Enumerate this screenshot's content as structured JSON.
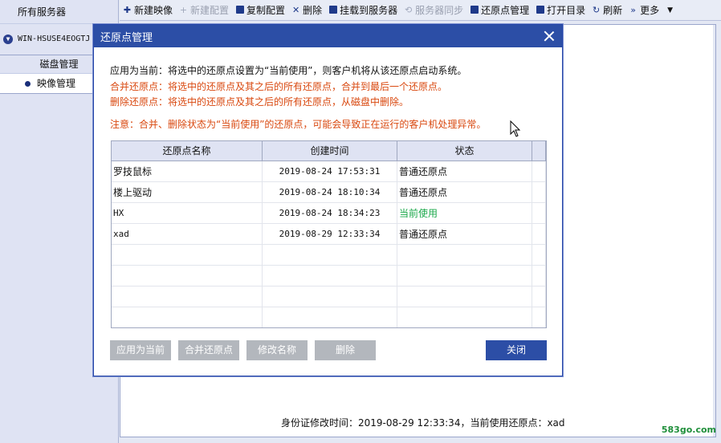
{
  "sidebar": {
    "header": "所有服务器",
    "server_name": "WIN-HSUSE4EOGTJ",
    "disk_mgmt": "磁盘管理",
    "image_mgmt": "映像管理"
  },
  "toolbar": {
    "new_image": "新建映像",
    "new_config": "新建配置",
    "copy_config": "复制配置",
    "delete": "删除",
    "mount_server": "挂载到服务器",
    "server_sync": "服务器同步",
    "restore_mgmt": "还原点管理",
    "open_dir": "打开目录",
    "refresh": "刷新",
    "more": "更多"
  },
  "dialog": {
    "title": "还原点管理",
    "desc_apply": "应用为当前：将选中的还原点设置为“当前使用”，则客户机将从该还原点启动系统。",
    "desc_merge": "合并还原点：将选中的还原点及其之后的所有还原点，合并到最后一个还原点。",
    "desc_delete": "删除还原点：将选中的还原点及其之后的所有还原点，从磁盘中删除。",
    "warning": "注意：合并、删除状态为“当前使用”的还原点，可能会导致正在运行的客户机处理异常。",
    "table": {
      "headers": [
        "还原点名称",
        "创建时间",
        "状态"
      ],
      "rows": [
        {
          "name": "罗技鼠标",
          "time": "2019-08-24 17:53:31",
          "status": "普通还原点"
        },
        {
          "name": "楼上驱动",
          "time": "2019-08-24 18:10:34",
          "status": "普通还原点"
        },
        {
          "name": "HX",
          "time": "2019-08-24 18:34:23",
          "status": "当前使用"
        },
        {
          "name": "xad",
          "time": "2019-08-29 12:33:34",
          "status": "普通还原点"
        }
      ]
    },
    "buttons": {
      "apply": "应用为当前",
      "merge": "合并还原点",
      "rename": "修改名称",
      "delete": "删除",
      "close": "关闭"
    }
  },
  "status_bar": "身份证修改时间：2019-08-29 12:33:34，当前使用还原点：xad",
  "watermark": "583go.com",
  "colors": {
    "title_bar": "#2c4ea6",
    "warning_text": "#d9480f",
    "current_status": "#1aa84a",
    "disabled_button": "#b3b7bd"
  }
}
